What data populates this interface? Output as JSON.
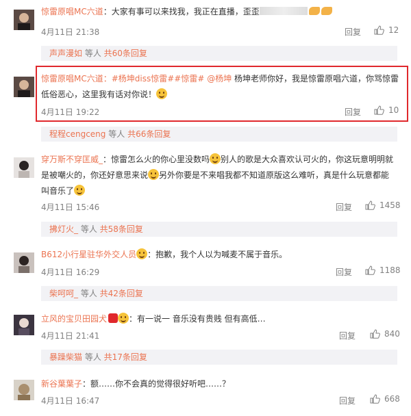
{
  "colors": {
    "accent": "#eb7350",
    "highlight_border": "#e0282c",
    "meta": "#808080"
  },
  "comments": [
    {
      "user": "惊雷原唱MC六道",
      "text": "：大家有事可以来找我，我正在直播，歪歪",
      "time": "4月11日 21:38",
      "reply": "回复",
      "likes": "12"
    },
    {
      "user": "惊雷原唱MC六道",
      "tags": "：#杨坤diss惊雷##惊雷# @杨坤",
      "text": " 杨坤老师你好，我是惊雷原唱六道，你骂惊雷低俗恶心，这里我有话对你说！",
      "time": "4月11日 19:22",
      "reply": "回复",
      "likes": "10"
    },
    {
      "user": "穿万斯不穿匡威_",
      "text": "：惊雷怎么火的你心里没数吗",
      "text2": "别人的歌是大众喜欢认可火的，你这玩意明明就是被嘲火的，你还好意思来说",
      "text3": "另外你要是不来唱我都不知道原版这么难听，真是什么玩意都能叫音乐了",
      "time": "4月11日 15:46",
      "reply": "回复",
      "likes": "1458"
    },
    {
      "user": "B612小行星驻华外交人员",
      "text": "：抱歉，我个人以为喊麦不属于音乐。",
      "time": "4月11日 16:29",
      "reply": "回复",
      "likes": "1188"
    },
    {
      "user": "立风的宝贝田园犬",
      "text": "：有一说一 音乐没有贵贱 但有高低…",
      "time": "4月11日 21:41",
      "reply": "回复",
      "likes": "840"
    },
    {
      "user": "新谷葉葉子",
      "text": "：额……你不会真的觉得很好听吧……？",
      "time": "4月11日 16:47",
      "reply": "回复",
      "likes": "668"
    }
  ],
  "subreplies": [
    {
      "user": "声声漫如",
      "mid": " 等人 ",
      "count": "共60条回复"
    },
    {
      "user": "程程cengceng",
      "mid": " 等人 ",
      "count": "共66条回复"
    },
    {
      "user": "拂灯火_",
      "mid": " 等人 ",
      "count": "共58条回复"
    },
    {
      "user": "柴呵呵_",
      "mid": " 等人 ",
      "count": "共42条回复"
    },
    {
      "user": "暴躁柴猫",
      "mid": " 等人 ",
      "count": "共17条回复"
    }
  ]
}
